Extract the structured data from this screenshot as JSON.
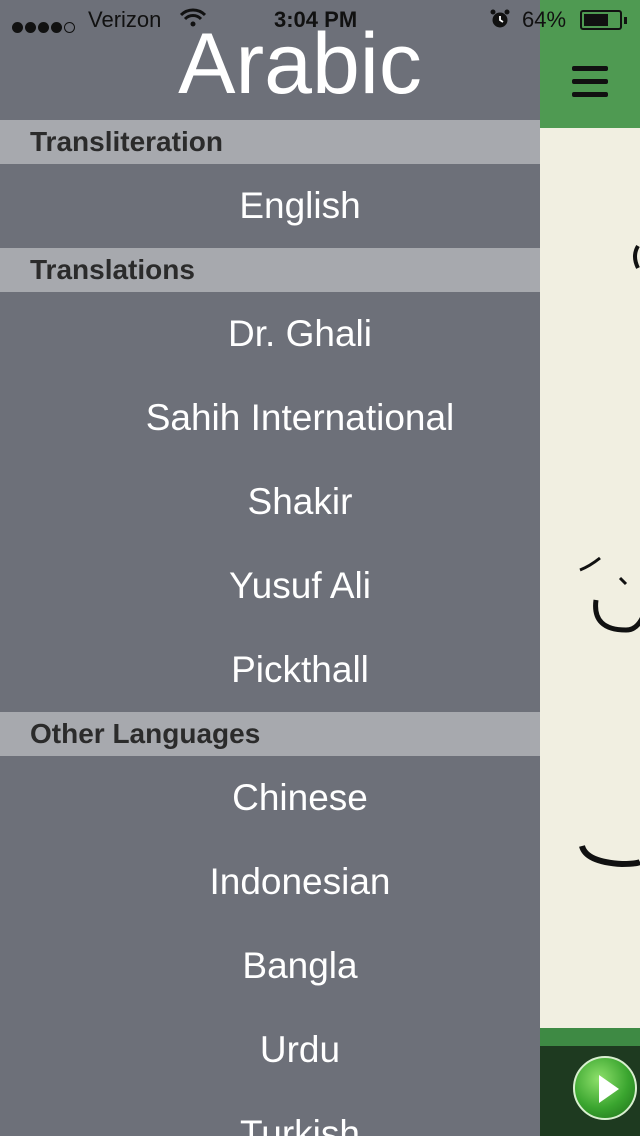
{
  "status_bar": {
    "carrier": "Verizon",
    "time": "3:04 PM",
    "battery": "64%"
  },
  "drawer": {
    "title": "Arabic",
    "sections": [
      {
        "header": "Transliteration",
        "items": [
          "English"
        ]
      },
      {
        "header": "Translations",
        "items": [
          "Dr. Ghali",
          "Sahih International",
          "Shakir",
          "Yusuf Ali",
          "Pickthall"
        ]
      },
      {
        "header": "Other Languages",
        "items": [
          "Chinese",
          "Indonesian",
          "Bangla",
          "Urdu",
          "Turkish"
        ]
      }
    ]
  },
  "icons": {
    "menu": "hamburger-menu-icon",
    "play": "play-icon",
    "wifi": "wifi-icon",
    "alarm": "alarm-icon",
    "battery": "battery-icon"
  },
  "colors": {
    "drawer_bg": "#6d7079",
    "section_header_bg": "#a7a9ae",
    "header_green": "#4f9a52",
    "content_bg": "#f1efe1"
  }
}
